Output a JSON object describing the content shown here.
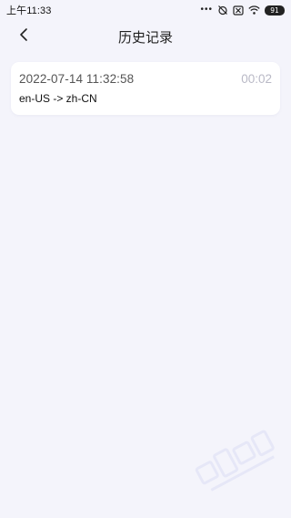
{
  "status_bar": {
    "time": "上午11:33",
    "dots": "•••",
    "battery": "91",
    "icons": [
      "alarm-off-icon",
      "sim-off-icon",
      "wifi-icon",
      "battery-icon"
    ]
  },
  "nav": {
    "title": "历史记录",
    "back_icon": "chevron-left-icon"
  },
  "records": [
    {
      "datetime": "2022-07-14 11:32:58",
      "duration": "00:02",
      "languages": "en-US -> zh-CN"
    }
  ],
  "colors": {
    "background": "#f4f4fb",
    "card": "#ffffff",
    "muted_text": "#b9b9c6",
    "watermark": "#d9dcf4"
  }
}
